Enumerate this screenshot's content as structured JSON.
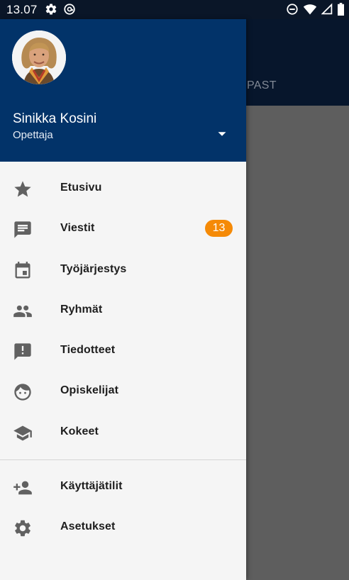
{
  "status_bar": {
    "time": "13.07",
    "icons": [
      "settings-icon",
      "at-sign-icon",
      "do-not-disturb-icon",
      "wifi-icon",
      "signal-icon",
      "battery-icon"
    ]
  },
  "background": {
    "tab_label": "PAST"
  },
  "drawer": {
    "user": {
      "name": "Sinikka Kosini",
      "role": "Opettaja"
    },
    "primary_items": [
      {
        "label": "Etusivu",
        "icon": "star-icon"
      },
      {
        "label": "Viestit",
        "icon": "message-icon",
        "badge": "13"
      },
      {
        "label": "Työjärjestys",
        "icon": "calendar-icon"
      },
      {
        "label": "Ryhmät",
        "icon": "group-icon"
      },
      {
        "label": "Tiedotteet",
        "icon": "announcement-icon"
      },
      {
        "label": "Opiskelijat",
        "icon": "face-icon"
      },
      {
        "label": "Kokeet",
        "icon": "school-icon"
      }
    ],
    "secondary_items": [
      {
        "label": "Käyttäjätilit",
        "icon": "person-add-icon"
      },
      {
        "label": "Asetukset",
        "icon": "settings-icon"
      }
    ]
  },
  "colors": {
    "drawer_header": "#023369",
    "badge": "#f58a07",
    "icon": "#616161",
    "status_bar": "#0a1628",
    "scrim": "#666666"
  }
}
